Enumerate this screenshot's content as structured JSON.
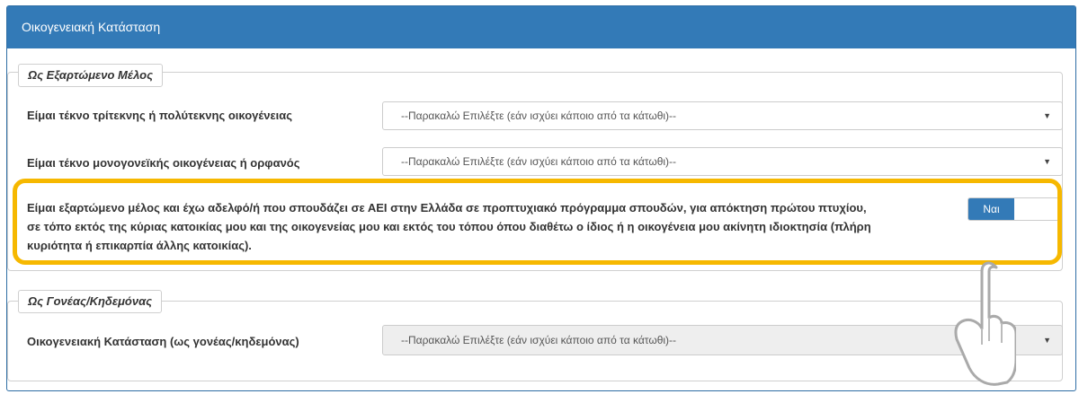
{
  "panel": {
    "title": "Οικογενειακή Κατάσταση"
  },
  "section_dependent": {
    "legend": "Ως Εξαρτώμενο Μέλος",
    "row1": {
      "label": "Είμαι τέκνο τρίτεκνης ή πολύτεκνης οικογένειας",
      "select_value": "--Παρακαλώ Επιλέξτε (εάν ισχύει κάποιο από τα κάτωθι)--"
    },
    "row2": {
      "label": "Είμαι τέκνο μονογονεϊκής οικογένειας ή ορφανός",
      "select_value": "--Παρακαλώ Επιλέξτε (εάν ισχύει κάποιο από τα κάτωθι)--"
    },
    "row3": {
      "label": "Είμαι εξαρτώμενο μέλος και έχω αδελφό/ή που σπουδάζει σε ΑΕΙ στην Ελλάδα σε προπτυχιακό πρόγραμμα σπουδών, για απόκτηση πρώτου πτυχίου, σε τόπο εκτός της κύριας κατοικίας μου και της οικογενείας μου και εκτός του τόπου όπου διαθέτω ο ίδιος ή η οικογένεια μου ακίνητη ιδιοκτησία (πλήρη κυριότητα ή επικαρπία άλλης κατοικίας).",
      "toggle_label": "Ναι",
      "toggle_state": "on"
    }
  },
  "section_parent": {
    "legend": "Ως Γονέας/Κηδεμόνας",
    "row1": {
      "label": "Οικογενειακή Κατάσταση (ως γονέας/κηδεμόνας)",
      "select_value": "--Παρακαλώ Επιλέξτε (εάν ισχύει κάποιο από τα κάτωθι)--"
    }
  },
  "colors": {
    "header": "#337ab7",
    "highlight": "#f6b800",
    "toggle_on": "#337ab7"
  },
  "icons": {
    "pointer": "hand-pointer-icon",
    "caret": "caret-down-icon"
  }
}
